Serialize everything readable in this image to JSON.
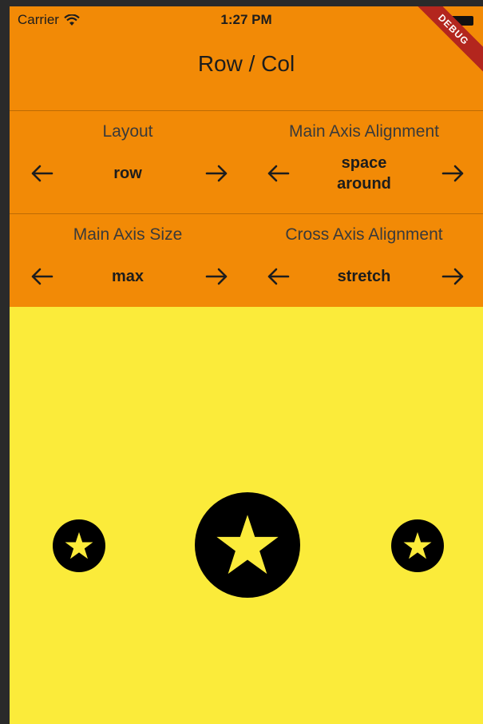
{
  "status_bar": {
    "carrier": "Carrier",
    "time": "1:27 PM"
  },
  "debug_banner": "DEBUG",
  "app_bar": {
    "title": "Row / Col"
  },
  "controls": {
    "layout": {
      "label": "Layout",
      "value": "row"
    },
    "main_axis_alignment": {
      "label": "Main Axis Alignment",
      "value": "space around"
    },
    "main_axis_size": {
      "label": "Main Axis Size",
      "value": "max"
    },
    "cross_axis_alignment": {
      "label": "Cross Axis Alignment",
      "value": "stretch"
    }
  },
  "icons": {
    "previous": "arrow-left-icon",
    "next": "arrow-right-icon",
    "star": "star-circle-icon"
  },
  "colors": {
    "app_bar": "#f28a06",
    "body": "#fbeb3a",
    "icon": "#000000",
    "debug_banner": "#b3261e"
  }
}
